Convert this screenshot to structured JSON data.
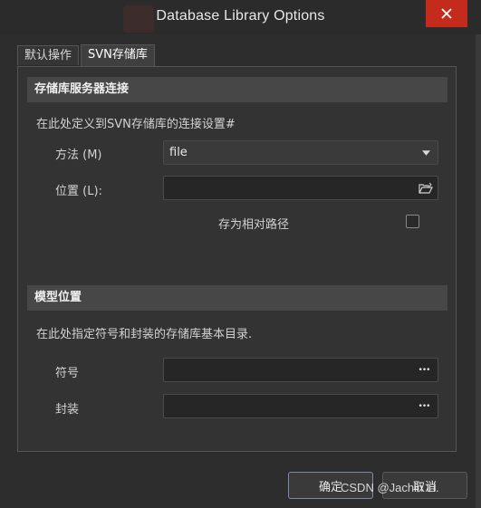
{
  "window": {
    "title": "Database Library Options",
    "close_icon": "close-icon"
  },
  "tabs": [
    {
      "label": "默认操作",
      "active": false
    },
    {
      "label": "SVN存储库",
      "active": true
    }
  ],
  "connection": {
    "header": "存储库服务器连接",
    "description": "在此处定义到SVN存储库的连接设置#",
    "method_label": "方法 (M)",
    "method_value": "file",
    "location_label": "位置 (L):",
    "location_value": "",
    "relative_path_label": "存为相对路径",
    "relative_path_checked": false
  },
  "models": {
    "header": "模型位置",
    "description": "在此处指定符号和封装的存储库基本目录.",
    "symbol_label": "符号",
    "symbol_value": "",
    "footprint_label": "封装",
    "footprint_value": "",
    "browse_glyph": "•••"
  },
  "footer": {
    "ok_label": "确定",
    "cancel_label": "取消"
  },
  "watermark": "CSDN @Jachin Li."
}
